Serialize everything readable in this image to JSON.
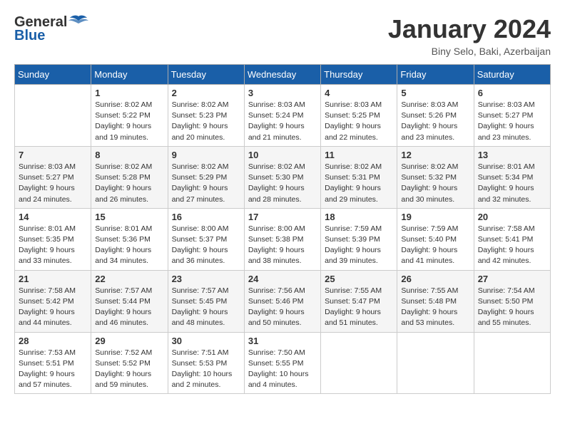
{
  "header": {
    "logo_line1": "General",
    "logo_line2": "Blue",
    "month": "January 2024",
    "location": "Biny Selo, Baki, Azerbaijan"
  },
  "weekdays": [
    "Sunday",
    "Monday",
    "Tuesday",
    "Wednesday",
    "Thursday",
    "Friday",
    "Saturday"
  ],
  "weeks": [
    [
      {
        "day": "",
        "info": ""
      },
      {
        "day": "1",
        "info": "Sunrise: 8:02 AM\nSunset: 5:22 PM\nDaylight: 9 hours\nand 19 minutes."
      },
      {
        "day": "2",
        "info": "Sunrise: 8:02 AM\nSunset: 5:23 PM\nDaylight: 9 hours\nand 20 minutes."
      },
      {
        "day": "3",
        "info": "Sunrise: 8:03 AM\nSunset: 5:24 PM\nDaylight: 9 hours\nand 21 minutes."
      },
      {
        "day": "4",
        "info": "Sunrise: 8:03 AM\nSunset: 5:25 PM\nDaylight: 9 hours\nand 22 minutes."
      },
      {
        "day": "5",
        "info": "Sunrise: 8:03 AM\nSunset: 5:26 PM\nDaylight: 9 hours\nand 23 minutes."
      },
      {
        "day": "6",
        "info": "Sunrise: 8:03 AM\nSunset: 5:27 PM\nDaylight: 9 hours\nand 23 minutes."
      }
    ],
    [
      {
        "day": "7",
        "info": "Sunrise: 8:03 AM\nSunset: 5:27 PM\nDaylight: 9 hours\nand 24 minutes."
      },
      {
        "day": "8",
        "info": "Sunrise: 8:02 AM\nSunset: 5:28 PM\nDaylight: 9 hours\nand 26 minutes."
      },
      {
        "day": "9",
        "info": "Sunrise: 8:02 AM\nSunset: 5:29 PM\nDaylight: 9 hours\nand 27 minutes."
      },
      {
        "day": "10",
        "info": "Sunrise: 8:02 AM\nSunset: 5:30 PM\nDaylight: 9 hours\nand 28 minutes."
      },
      {
        "day": "11",
        "info": "Sunrise: 8:02 AM\nSunset: 5:31 PM\nDaylight: 9 hours\nand 29 minutes."
      },
      {
        "day": "12",
        "info": "Sunrise: 8:02 AM\nSunset: 5:32 PM\nDaylight: 9 hours\nand 30 minutes."
      },
      {
        "day": "13",
        "info": "Sunrise: 8:01 AM\nSunset: 5:34 PM\nDaylight: 9 hours\nand 32 minutes."
      }
    ],
    [
      {
        "day": "14",
        "info": "Sunrise: 8:01 AM\nSunset: 5:35 PM\nDaylight: 9 hours\nand 33 minutes."
      },
      {
        "day": "15",
        "info": "Sunrise: 8:01 AM\nSunset: 5:36 PM\nDaylight: 9 hours\nand 34 minutes."
      },
      {
        "day": "16",
        "info": "Sunrise: 8:00 AM\nSunset: 5:37 PM\nDaylight: 9 hours\nand 36 minutes."
      },
      {
        "day": "17",
        "info": "Sunrise: 8:00 AM\nSunset: 5:38 PM\nDaylight: 9 hours\nand 38 minutes."
      },
      {
        "day": "18",
        "info": "Sunrise: 7:59 AM\nSunset: 5:39 PM\nDaylight: 9 hours\nand 39 minutes."
      },
      {
        "day": "19",
        "info": "Sunrise: 7:59 AM\nSunset: 5:40 PM\nDaylight: 9 hours\nand 41 minutes."
      },
      {
        "day": "20",
        "info": "Sunrise: 7:58 AM\nSunset: 5:41 PM\nDaylight: 9 hours\nand 42 minutes."
      }
    ],
    [
      {
        "day": "21",
        "info": "Sunrise: 7:58 AM\nSunset: 5:42 PM\nDaylight: 9 hours\nand 44 minutes."
      },
      {
        "day": "22",
        "info": "Sunrise: 7:57 AM\nSunset: 5:44 PM\nDaylight: 9 hours\nand 46 minutes."
      },
      {
        "day": "23",
        "info": "Sunrise: 7:57 AM\nSunset: 5:45 PM\nDaylight: 9 hours\nand 48 minutes."
      },
      {
        "day": "24",
        "info": "Sunrise: 7:56 AM\nSunset: 5:46 PM\nDaylight: 9 hours\nand 50 minutes."
      },
      {
        "day": "25",
        "info": "Sunrise: 7:55 AM\nSunset: 5:47 PM\nDaylight: 9 hours\nand 51 minutes."
      },
      {
        "day": "26",
        "info": "Sunrise: 7:55 AM\nSunset: 5:48 PM\nDaylight: 9 hours\nand 53 minutes."
      },
      {
        "day": "27",
        "info": "Sunrise: 7:54 AM\nSunset: 5:50 PM\nDaylight: 9 hours\nand 55 minutes."
      }
    ],
    [
      {
        "day": "28",
        "info": "Sunrise: 7:53 AM\nSunset: 5:51 PM\nDaylight: 9 hours\nand 57 minutes."
      },
      {
        "day": "29",
        "info": "Sunrise: 7:52 AM\nSunset: 5:52 PM\nDaylight: 9 hours\nand 59 minutes."
      },
      {
        "day": "30",
        "info": "Sunrise: 7:51 AM\nSunset: 5:53 PM\nDaylight: 10 hours\nand 2 minutes."
      },
      {
        "day": "31",
        "info": "Sunrise: 7:50 AM\nSunset: 5:55 PM\nDaylight: 10 hours\nand 4 minutes."
      },
      {
        "day": "",
        "info": ""
      },
      {
        "day": "",
        "info": ""
      },
      {
        "day": "",
        "info": ""
      }
    ]
  ]
}
